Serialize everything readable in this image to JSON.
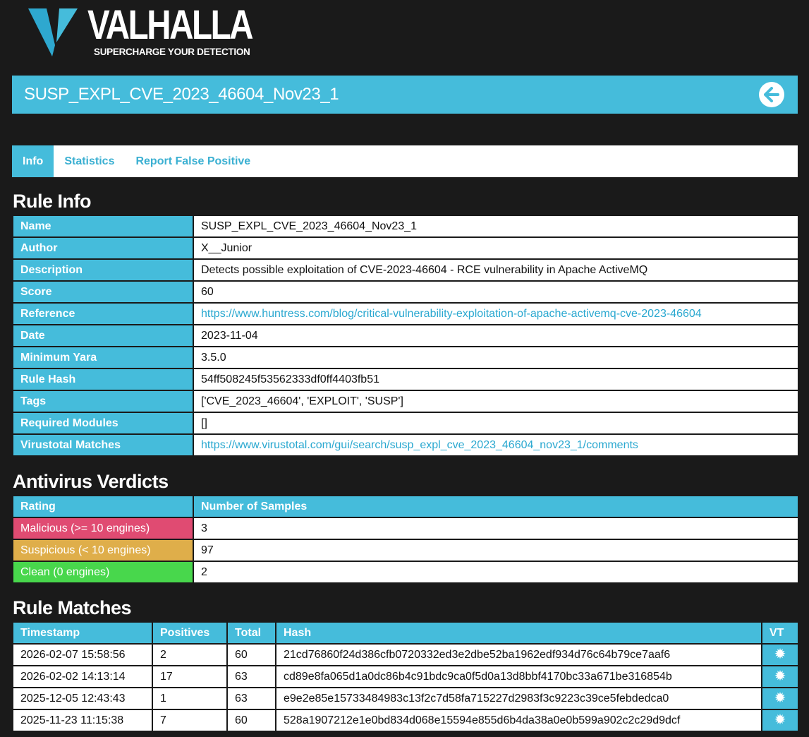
{
  "brand": {
    "name": "VALHALLA",
    "tagline": "SUPERCHARGE YOUR DETECTION",
    "accent": "#45bcdb"
  },
  "rule_title": "SUSP_EXPL_CVE_2023_46604_Nov23_1",
  "tabs": [
    {
      "label": "Info",
      "active": true
    },
    {
      "label": "Statistics",
      "active": false
    },
    {
      "label": "Report False Positive",
      "active": false
    }
  ],
  "rule_info": {
    "heading": "Rule Info",
    "rows": [
      {
        "key": "Name",
        "value": "SUSP_EXPL_CVE_2023_46604_Nov23_1"
      },
      {
        "key": "Author",
        "value": "X__Junior"
      },
      {
        "key": "Description",
        "value": "Detects possible exploitation of CVE-2023-46604 - RCE vulnerability in Apache ActiveMQ"
      },
      {
        "key": "Score",
        "value": "60"
      },
      {
        "key": "Reference",
        "value": "https://www.huntress.com/blog/critical-vulnerability-exploitation-of-apache-activemq-cve-2023-46604"
      },
      {
        "key": "Date",
        "value": "2023-11-04"
      },
      {
        "key": "Minimum Yara",
        "value": "3.5.0"
      },
      {
        "key": "Rule Hash",
        "value": "54ff508245f53562333df0ff4403fb51"
      },
      {
        "key": "Tags",
        "value": "['CVE_2023_46604', 'EXPLOIT', 'SUSP']"
      },
      {
        "key": "Required Modules",
        "value": "[]"
      },
      {
        "key": "Virustotal Matches",
        "value": "https://www.virustotal.com/gui/search/susp_expl_cve_2023_46604_nov23_1/comments"
      }
    ]
  },
  "av_verdicts": {
    "heading": "Antivirus Verdicts",
    "headers": [
      "Rating",
      "Number of Samples"
    ],
    "rows": [
      {
        "rating": "Malicious (>= 10 engines)",
        "count": "3",
        "color": "#e04b72"
      },
      {
        "rating": "Suspicious (< 10 engines)",
        "count": "97",
        "color": "#dfae4a"
      },
      {
        "rating": "Clean (0 engines)",
        "count": "2",
        "color": "#48d74c"
      }
    ]
  },
  "rule_matches": {
    "heading": "Rule Matches",
    "headers": [
      "Timestamp",
      "Positives",
      "Total",
      "Hash",
      "VT"
    ],
    "rows": [
      {
        "timestamp": "2026-02-07 15:58:56",
        "positives": "2",
        "total": "60",
        "hash": "21cd76860f24d386cfb0720332ed3e2dbe52ba1962edf934d76c64b79ce7aaf6",
        "vt_icon": "gear-icon"
      },
      {
        "timestamp": "2026-02-02 14:13:14",
        "positives": "17",
        "total": "63",
        "hash": "cd89e8fa065d1a0dc86b4c91bdc9ca0f5d0a13d8bbf4170bc33a671be316854b",
        "vt_icon": "gear-icon"
      },
      {
        "timestamp": "2025-12-05 12:43:43",
        "positives": "1",
        "total": "63",
        "hash": "e9e2e85e15733484983c13f2c7d58fa715227d2983f3c9223c39ce5febdedca0",
        "vt_icon": "gear-icon"
      },
      {
        "timestamp": "2025-11-23 11:15:38",
        "positives": "7",
        "total": "60",
        "hash": "528a1907212e1e0bd834d068e15594e855d6b4da38a0e0b599a902c2c29d9dcf",
        "vt_icon": "gear-icon"
      }
    ]
  }
}
